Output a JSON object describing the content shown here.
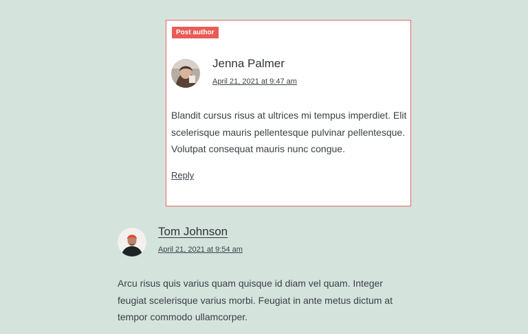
{
  "post_author_comment": {
    "badge": "Post author",
    "author": "Jenna Palmer",
    "date": "April 21, 2021 at 9:47 am",
    "body": "Blandit cursus risus at ultrices mi tempus imperdiet. Elit scelerisque mauris pellentesque pulvinar pellentesque. Volutpat consequat mauris nunc congue.",
    "reply_label": "Reply"
  },
  "reply_comment": {
    "author": "Tom Johnson",
    "date": "April 21, 2021 at 9:54 am",
    "body": "Arcu risus quis varius quam quisque id diam vel quam. Integer feugiat scelerisque varius morbi. Feugiat in ante metus dictum at tempor commodo ullamcorper."
  },
  "colors": {
    "page_background": "#d5e3dd",
    "card_border": "#e0675d",
    "badge_background": "#e85c55",
    "text": "#3a3f45"
  }
}
